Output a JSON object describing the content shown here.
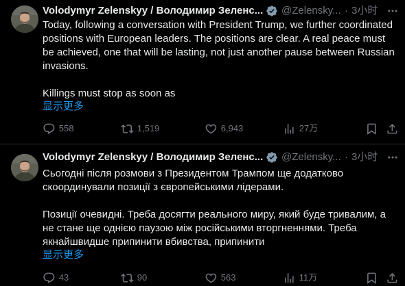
{
  "colors": {
    "background": "#000000",
    "text": "#e7e9ea",
    "secondary": "#71767b",
    "link": "#1d9bf0",
    "verified": "#829aab",
    "divider": "#2f3336"
  },
  "tweets": [
    {
      "author_name": "Volodymyr Zelenskyy / Володимир Зеленс...",
      "handle": "@Zelensky...",
      "dot": "·",
      "time": "3小时",
      "more_icon": "more-horizontal-icon",
      "paragraphs": [
        "Today, following a conversation with President Trump, we further coordinated positions with European leaders. The positions are clear. A real peace must be achieved, one that will be lasting, not just another pause between Russian invasions.",
        "Killings must stop as soon as"
      ],
      "show_more": "显示更多",
      "replies": "558",
      "reposts": "1,519",
      "likes": "6,943",
      "views": "27万"
    },
    {
      "author_name": "Volodymyr Zelenskyy / Володимир Зеленс...",
      "handle": "@Zelensky...",
      "dot": "·",
      "time": "3小时",
      "more_icon": "more-horizontal-icon",
      "paragraphs": [
        "Сьогодні після розмови з Президентом Трампом ще додатково скоординували позиції з європейськими лідерами.",
        "Позиції очевидні. Треба досягти реального миру, який буде тривалим, а не стане ще однією паузою між російськими вторгненнями. Треба якнайшвидше припинити вбивства, припинити"
      ],
      "show_more": "显示更多",
      "replies": "43",
      "reposts": "90",
      "likes": "563",
      "views": "11万"
    }
  ]
}
